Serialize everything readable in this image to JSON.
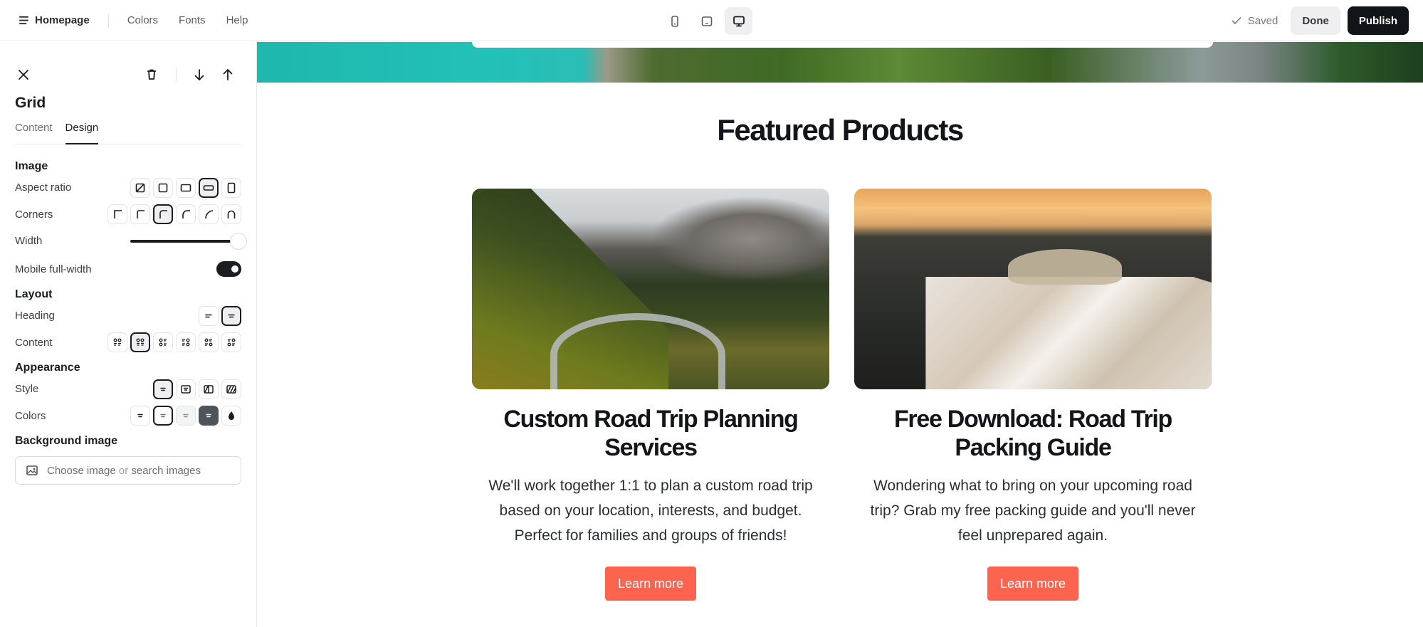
{
  "topbar": {
    "page_menu_label": "Homepage",
    "nav": [
      "Colors",
      "Fonts",
      "Help"
    ],
    "devices": [
      {
        "name": "mobile",
        "active": false
      },
      {
        "name": "tablet",
        "active": false
      },
      {
        "name": "desktop",
        "active": true
      }
    ],
    "status": "Saved",
    "done_label": "Done",
    "publish_label": "Publish"
  },
  "panel": {
    "title": "Grid",
    "tabs": [
      {
        "label": "Content",
        "active": false
      },
      {
        "label": "Design",
        "active": true
      }
    ],
    "sections": {
      "image": {
        "title": "Image",
        "aspect_ratio_label": "Aspect ratio",
        "aspect_ratio_options": [
          "original",
          "square",
          "landscape",
          "wide",
          "portrait"
        ],
        "aspect_ratio_selected": "wide",
        "corners_label": "Corners",
        "corners_options": [
          "square",
          "slight",
          "small",
          "medium",
          "large",
          "round"
        ],
        "corners_selected": "small",
        "width_label": "Width",
        "width_value": 1.0,
        "mobile_full_width_label": "Mobile full-width",
        "mobile_full_width": true
      },
      "layout": {
        "title": "Layout",
        "heading_label": "Heading",
        "heading_options": [
          "left",
          "center"
        ],
        "heading_selected": "center",
        "content_label": "Content",
        "content_options": [
          "grid-left",
          "grid-center",
          "list-image-left",
          "list-image-right",
          "alternate-left",
          "alternate-right"
        ],
        "content_selected": "grid-center"
      },
      "appearance": {
        "title": "Appearance",
        "style_label": "Style",
        "style_options": [
          "plain",
          "card",
          "split",
          "overlay"
        ],
        "style_selected": "plain",
        "colors_label": "Colors",
        "colors_options": [
          "default",
          "outline",
          "light",
          "dark",
          "custom"
        ],
        "colors_selected": "outline"
      },
      "background": {
        "title": "Background image",
        "choose_label": "Choose image",
        "or_label": "or",
        "search_label": "search images"
      }
    }
  },
  "canvas": {
    "section_heading": "Featured Products",
    "products": [
      {
        "image_alt": "Winding mountain road through autumn forest",
        "title": "Custom Road Trip Planning Services",
        "description": "We'll work together 1:1 to plan a custom road trip based on your location, interests, and budget. Perfect for families and groups of friends!",
        "cta": "Learn more"
      },
      {
        "image_alt": "Folded road map on car dashboard at sunset",
        "title": "Free Download: Road Trip Packing Guide",
        "description": "Wondering what to bring on your upcoming road trip? Grab my free packing guide and you'll never feel unprepared again.",
        "cta": "Learn more"
      }
    ],
    "accent_color": "#fd644f"
  }
}
